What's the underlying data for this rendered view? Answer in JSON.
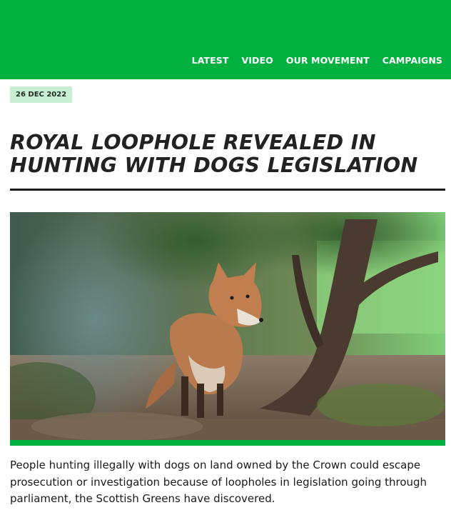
{
  "nav": {
    "items": [
      {
        "label": "LATEST"
      },
      {
        "label": "VIDEO"
      },
      {
        "label": "OUR MOVEMENT"
      },
      {
        "label": "CAMPAIGNS"
      }
    ]
  },
  "article": {
    "date": "26 DEC 2022",
    "title": "ROYAL LOOPHOLE REVEALED IN HUNTING WITH DOGS LEGISLATION",
    "lede": "People hunting illegally with dogs on land owned by the Crown could escape prosecution or investigation because of loopholes in legislation going through parliament, the Scottish Greens have discovered."
  },
  "colors": {
    "brand_green": "#00b140",
    "badge_bg": "#c9efd2",
    "text": "#1a1a1a"
  }
}
